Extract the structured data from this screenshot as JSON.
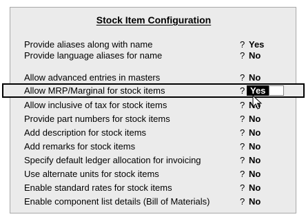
{
  "title": "Stock Item Configuration",
  "options": [
    {
      "label": "Provide aliases along with name",
      "q": "?",
      "value": "Yes"
    },
    {
      "label": "Provide language aliases for name",
      "q": "?",
      "value": "No"
    },
    {
      "label": "Allow advanced entries in masters",
      "q": "?",
      "value": "No"
    },
    {
      "label": "Allow MRP/Marginal for stock items",
      "q": "?",
      "value": "Yes"
    },
    {
      "label": "Allow inclusive of tax for stock items",
      "q": "?",
      "value": "No"
    },
    {
      "label": "Provide part numbers for stock items",
      "q": "?",
      "value": "No"
    },
    {
      "label": "Add description for stock items",
      "q": "?",
      "value": "No"
    },
    {
      "label": "Add remarks for stock items",
      "q": "?",
      "value": "No"
    },
    {
      "label": "Specify default ledger allocation for invoicing",
      "q": "?",
      "value": "No"
    },
    {
      "label": "Use alternate units for stock items",
      "q": "?",
      "value": "No"
    },
    {
      "label": "Enable standard rates for stock items",
      "q": "?",
      "value": "No"
    },
    {
      "label": "Enable component list details (Bill of Materials)",
      "q": "?",
      "value": "No"
    }
  ],
  "colors": {
    "panel_bg": "#ebebeb",
    "selected_value_bg": "#000000",
    "selected_value_fg": "#ffffff"
  },
  "icons": {
    "cursor": "arrow-pointer-icon"
  }
}
